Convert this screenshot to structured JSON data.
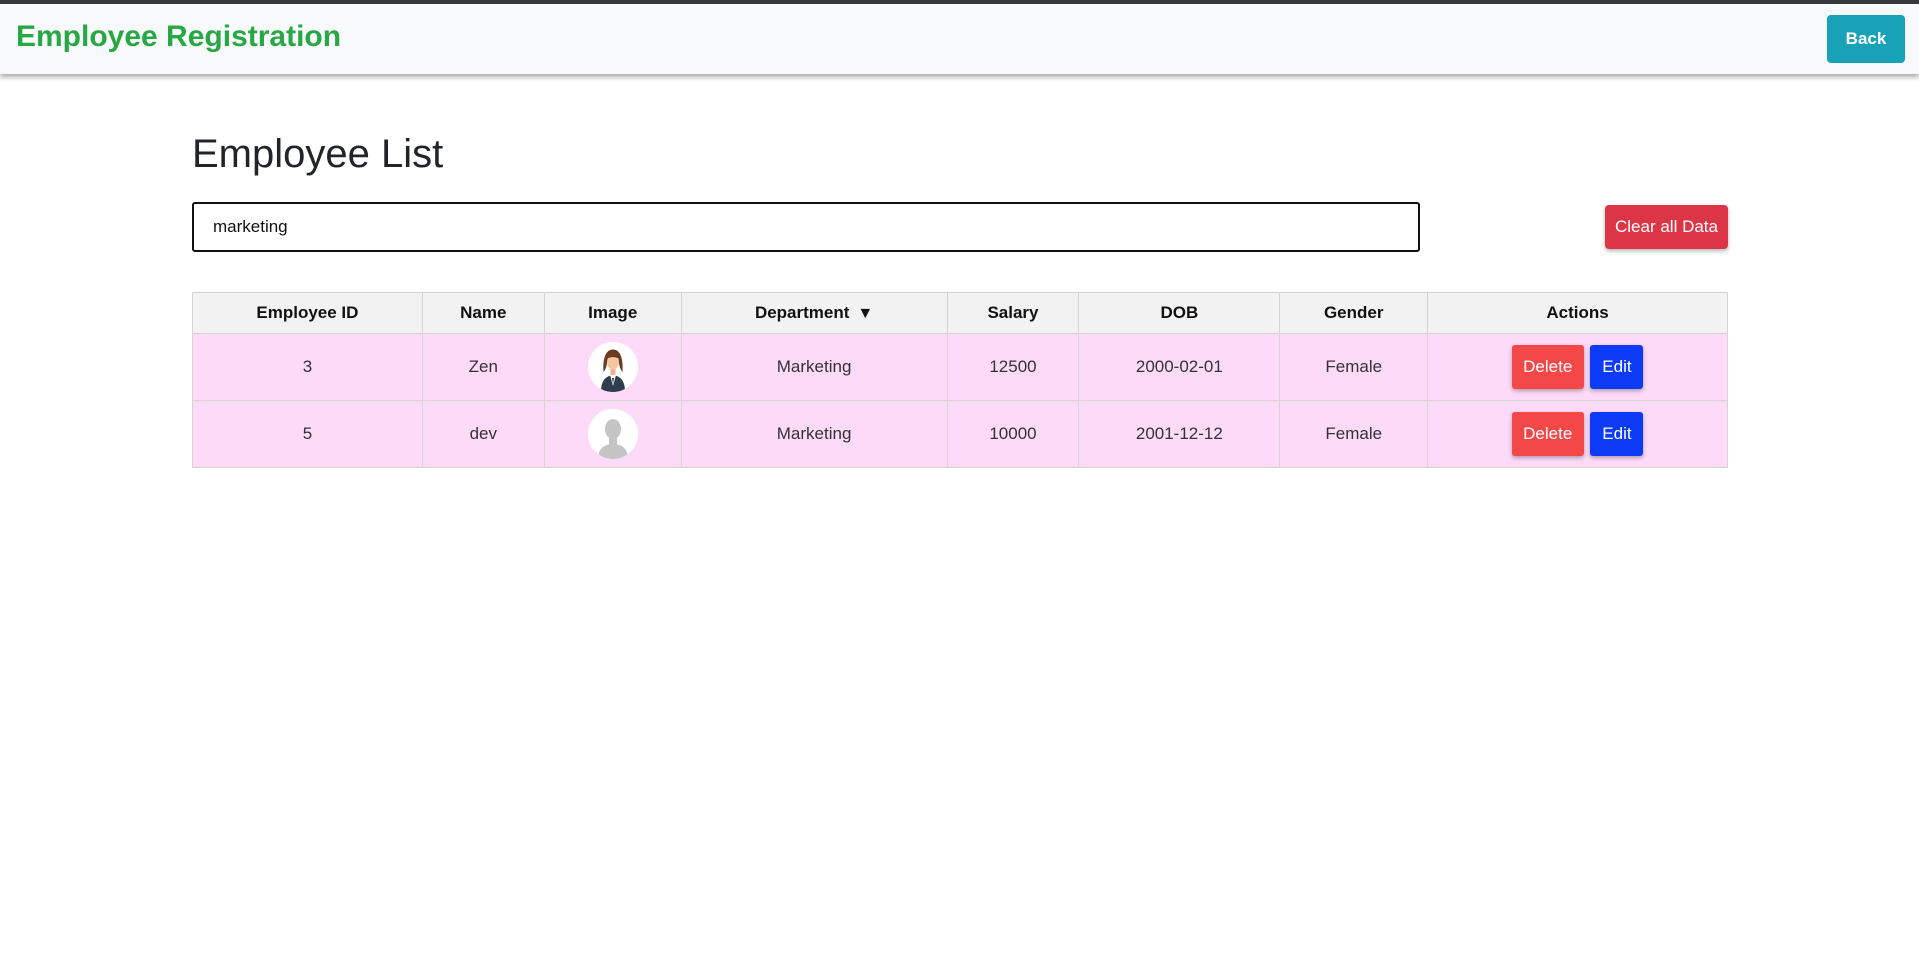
{
  "navbar": {
    "brand": "Employee Registration",
    "back_label": "Back"
  },
  "page": {
    "title": "Employee List"
  },
  "search": {
    "value": "marketing"
  },
  "clear_label": "Clear all Data",
  "table": {
    "headers": [
      "Employee ID",
      "Name",
      "Image",
      "Department",
      "Salary",
      "DOB",
      "Gender",
      "Actions"
    ],
    "sort_indicator": "▼",
    "rows": [
      {
        "id": "3",
        "name": "Zen",
        "image": "female-avatar-icon",
        "department": "Marketing",
        "salary": "12500",
        "dob": "2000-02-01",
        "gender": "Female"
      },
      {
        "id": "5",
        "name": "dev",
        "image": "default-avatar-icon",
        "department": "Marketing",
        "salary": "10000",
        "dob": "2001-12-12",
        "gender": "Female"
      }
    ],
    "delete_label": "Delete",
    "edit_label": "Edit"
  },
  "colors": {
    "brand": "#28a745",
    "back_button": "#17a2b8",
    "clear_button": "#dc3545",
    "delete_button": "#f44848",
    "edit_button": "#0d3bf5",
    "row_background": "#fddaf8",
    "header_background": "#f2f2f2"
  }
}
